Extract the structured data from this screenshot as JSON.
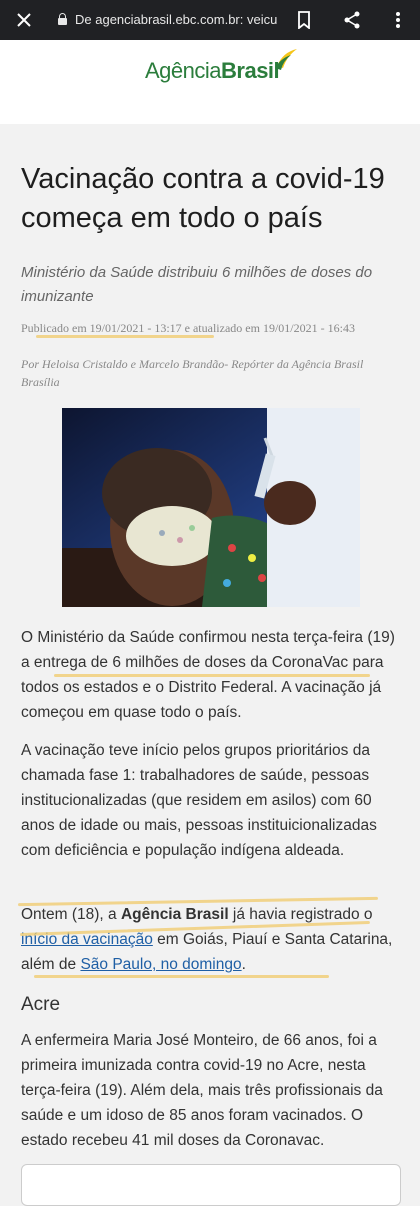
{
  "browser": {
    "url": "De agenciabrasil.ebc.com.br: veicul",
    "icons": [
      "close-icon",
      "lock-icon",
      "bookmark-icon",
      "share-icon",
      "more-icon"
    ]
  },
  "site": {
    "logo_part1": "Agência",
    "logo_part2": "Brasil"
  },
  "article": {
    "title": "Vacinação contra a covid-19 começa em todo o país",
    "subtitle": "Ministério da Saúde distribuiu 6 milhões de doses do imunizante",
    "published": "Publicado em 19/01/2021 - 13:17 e atualizado em 19/01/2021 - 16:43",
    "byline": "Por Heloisa Cristaldo e Marcelo Brandão- Repórter da Agência Brasil Brasília",
    "p1": "O Ministério da Saúde confirmou nesta terça-feira (19) a entrega de 6 milhões de doses da CoronaVac para todos os estados e o Distrito Federal. A vacinação já começou em quase todo o país.",
    "p2": "A vacinação teve início pelos grupos prioritários da chamada fase 1: trabalhadores de saúde, pessoas institucionalizadas (que residem em asilos) com 60 anos de idade ou mais, pessoas instituicionalizadas com deficiência e população indígena aldeada.",
    "p3": {
      "t1": "Ontem (18), a ",
      "bold": "Agência Brasil",
      "t2": " já havia registrado o ",
      "link1": "início da vacinação",
      "t3": " em Goiás, Piauí e Santa Catarina, além de ",
      "link2": "São Paulo, no domingo",
      "t4": "."
    },
    "section_heading": "Acre",
    "p4": "A enfermeira Maria José Monteiro, de 66 anos, foi a primeira imunizada contra covid-19 no Acre, nesta terça-feira (19). Além dela, mais três profissionais da saúde e um idoso de 85 anos foram vacinados. O estado recebeu 41 mil doses da Coronavac."
  },
  "colors": {
    "brand_green": "#2b7d3c",
    "brand_yellow": "#f5c518",
    "link": "#1f5fa5",
    "highlight": "#f0c96a"
  }
}
